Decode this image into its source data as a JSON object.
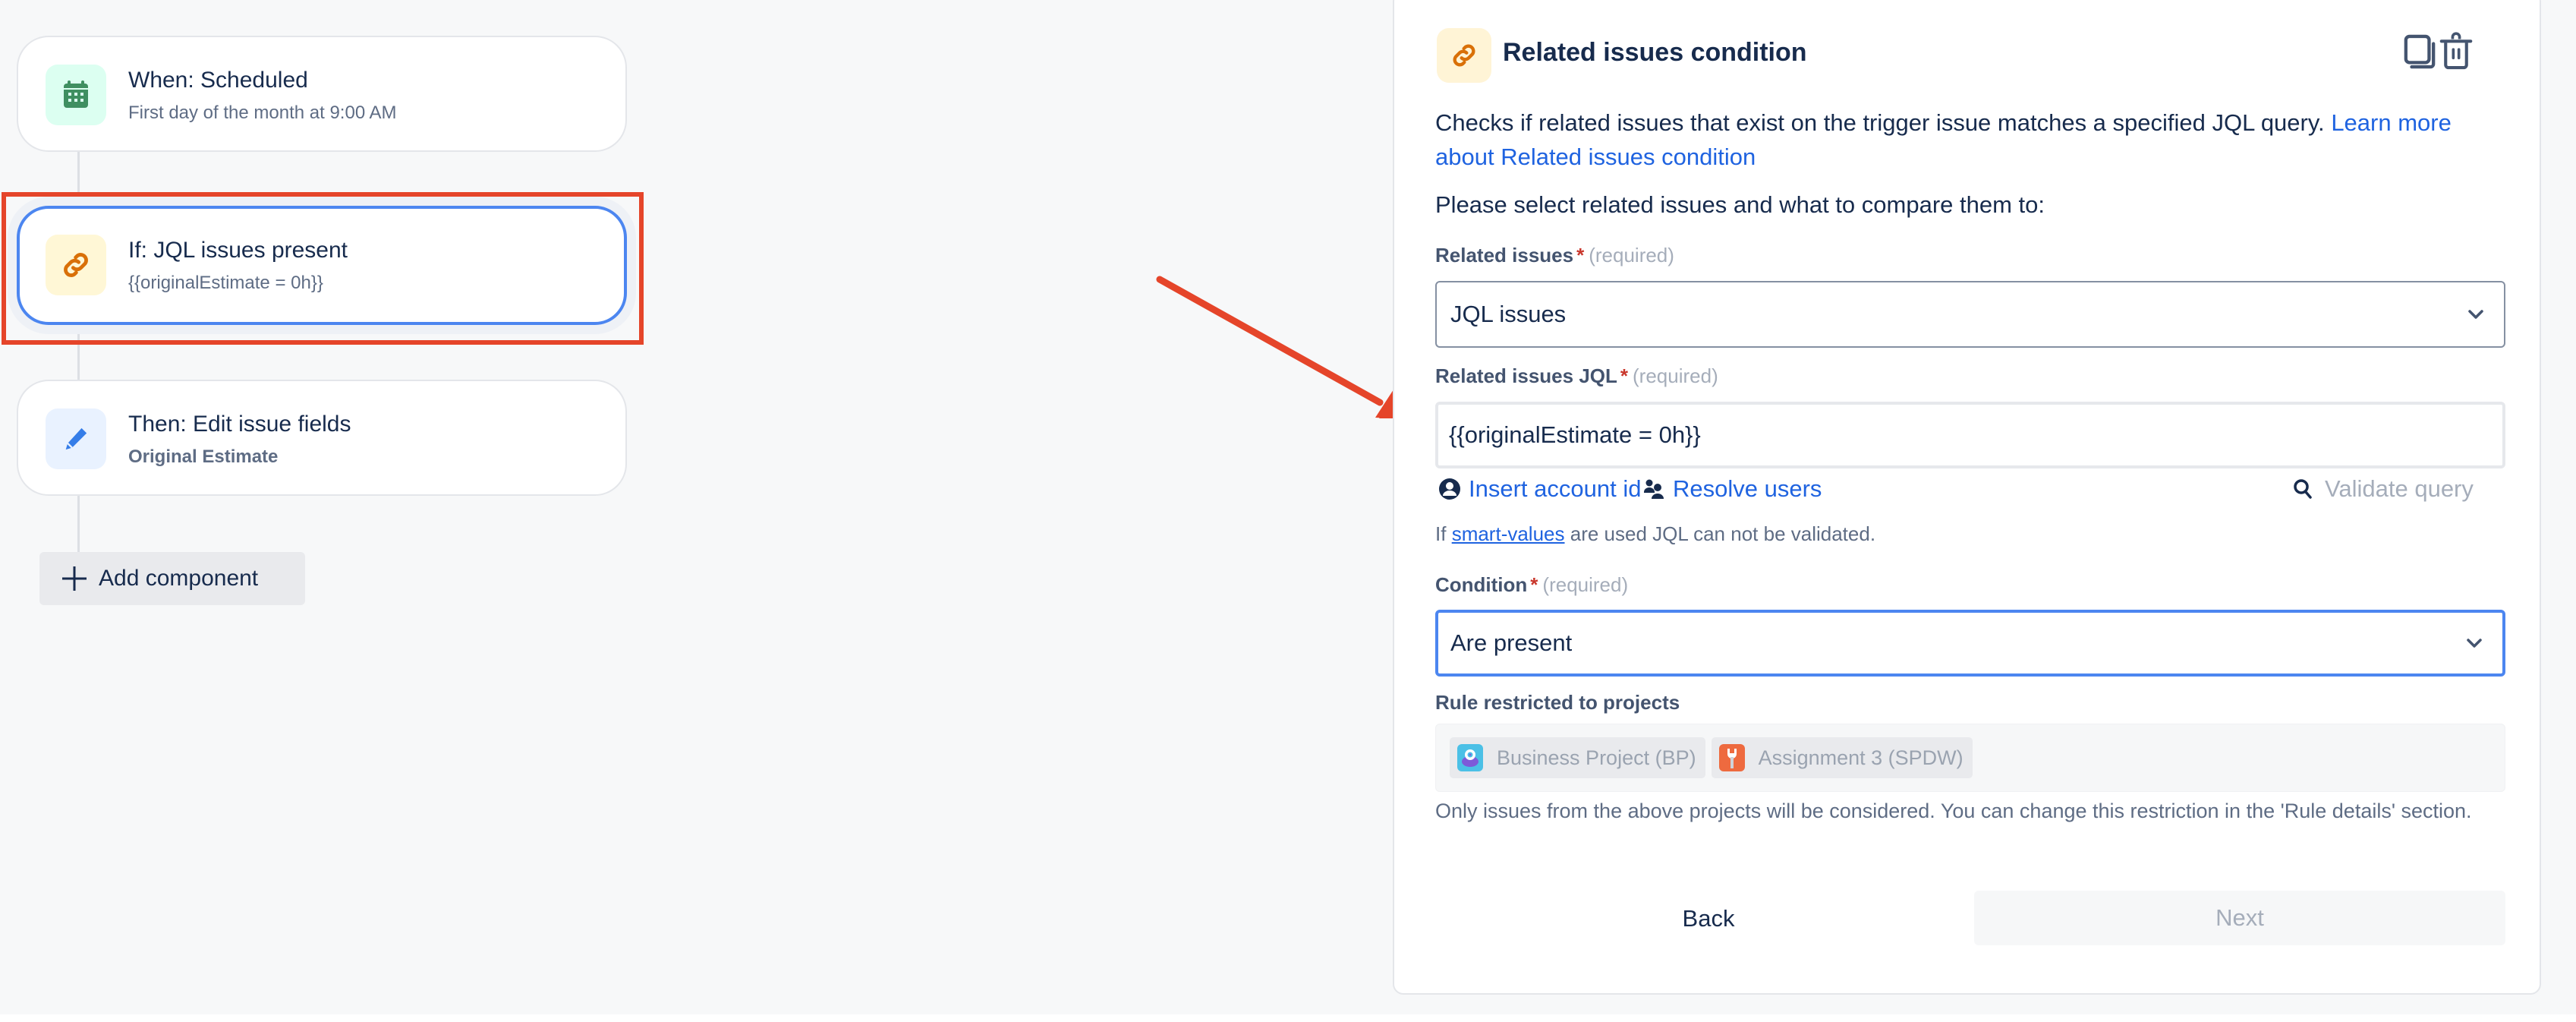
{
  "flow": {
    "nodes": [
      {
        "title": "When: Scheduled",
        "subtitle": "First day of the month at 9:00 AM",
        "icon": "calendar-icon",
        "accent": "#3f8f61",
        "tile": "#dcfff1"
      },
      {
        "title": "If: JQL issues present",
        "subtitle": "{{originalEstimate = 0h}}",
        "icon": "link-icon",
        "accent": "#d97008",
        "tile": "#fff7d6",
        "selected": true
      },
      {
        "title": "Then: Edit issue fields",
        "subtitle": "Original Estimate",
        "icon": "pencil-icon",
        "accent": "#357de8",
        "tile": "#e9f2ff"
      }
    ],
    "add_component_label": "Add component"
  },
  "annotation": {
    "highlight_color": "#e5452a"
  },
  "panel": {
    "title": "Related issues condition",
    "description": "Checks if related issues that exist on the trigger issue matches a specified JQL query.",
    "learn_more_link": "Learn more about Related issues condition",
    "prompt": "Please select related issues and what to compare them to:",
    "required_star": "*",
    "required_text": "(required)",
    "related_issues": {
      "label": "Related issues",
      "value": "JQL issues"
    },
    "related_jql": {
      "label": "Related issues JQL",
      "value": "{{originalEstimate = 0h}}"
    },
    "insert_account_id": "Insert account id",
    "resolve_users": "Resolve users",
    "validate_query": "Validate query",
    "hint_prefix": "If",
    "hint_link": "smart-values",
    "hint_suffix": "are used JQL can not be validated.",
    "condition": {
      "label": "Condition",
      "value": "Are present"
    },
    "projects": {
      "label": "Rule restricted to projects",
      "items": [
        {
          "name": "Business Project (BP)",
          "icon_color": "#4bc0e6"
        },
        {
          "name": "Assignment 3 (SPDW)",
          "icon_color": "#ee6a3f"
        }
      ]
    },
    "footnote": "Only issues from the above projects will be considered. You can change this restriction in the 'Rule details' section.",
    "back_label": "Back",
    "next_label": "Next",
    "link_color": "#1f63e0"
  }
}
